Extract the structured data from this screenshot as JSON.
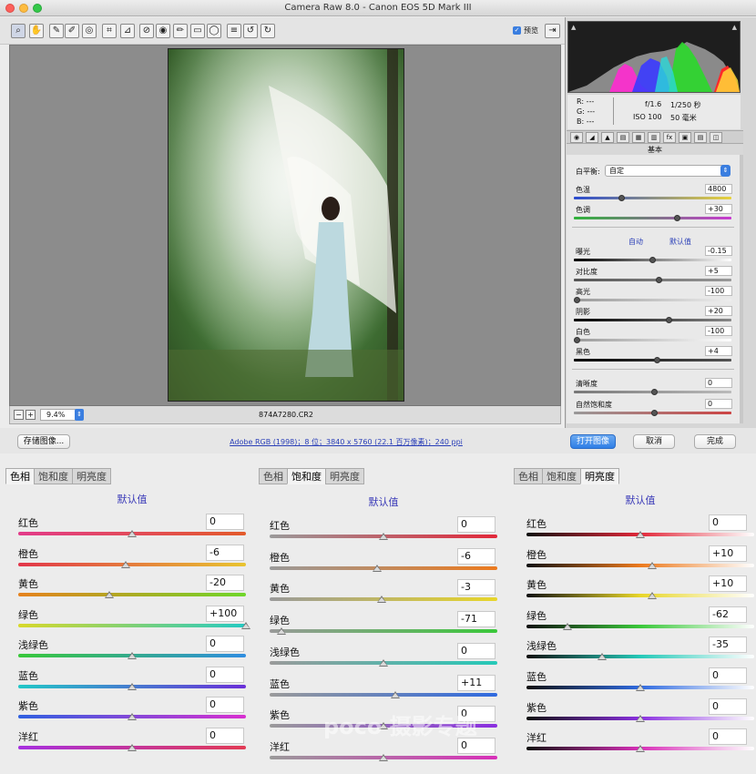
{
  "window": {
    "title": "Camera Raw 8.0 -  Canon EOS 5D Mark III"
  },
  "toolbar": {
    "tools": [
      "zoom-icon",
      "hand-icon",
      "white-balance-icon",
      "color-sampler-icon",
      "target-adjust-icon",
      "crop-icon",
      "straighten-icon",
      "spot-removal-icon",
      "red-eye-icon",
      "adjustment-brush-icon",
      "graduated-filter-icon",
      "radial-filter-icon",
      "list-icon",
      "rotate-left-icon",
      "rotate-right-icon"
    ],
    "preview_label": "预览",
    "preview_checked": true
  },
  "status": {
    "zoom": "9.4%",
    "filename": "874A7280.CR2"
  },
  "bottom": {
    "save_label": "存储图像...",
    "workflow_link": "Adobe RGB (1998)；8 位；3840 x 5760 (22.1 百万像素)；240 ppi",
    "open_label": "打开图像",
    "cancel_label": "取消",
    "done_label": "完成"
  },
  "info": {
    "r": "R:  ---",
    "g": "G:  ---",
    "b": "B:  ---",
    "aperture": "f/1.6",
    "shutter": "1/250 秒",
    "iso": "ISO 100",
    "focal": "50 毫米"
  },
  "panel": {
    "title": "基本",
    "wb_label": "白平衡:",
    "wb_value": "自定",
    "auto_label": "自动",
    "default_label": "默认值",
    "sliders": [
      {
        "label": "色温",
        "value": "4800",
        "pos": 0.29,
        "grad": "linear-gradient(90deg,#2a4ad0,#e8d23c)"
      },
      {
        "label": "色调",
        "value": "+30",
        "pos": 0.65,
        "grad": "linear-gradient(90deg,#2fb33a,#c83ad0)"
      },
      {
        "label": "曝光",
        "value": "-0.15",
        "pos": 0.49,
        "grad": "linear-gradient(90deg,#000,#fff)"
      },
      {
        "label": "对比度",
        "value": "+5",
        "pos": 0.53,
        "grad": "linear-gradient(90deg,#555,#999)"
      },
      {
        "label": "高光",
        "value": "-100",
        "pos": 0.0,
        "grad": "linear-gradient(90deg,#999,#eee)"
      },
      {
        "label": "阴影",
        "value": "+20",
        "pos": 0.6,
        "grad": "linear-gradient(90deg,#000,#888)"
      },
      {
        "label": "白色",
        "value": "-100",
        "pos": 0.0,
        "grad": "linear-gradient(90deg,#999,#fff)"
      },
      {
        "label": "黑色",
        "value": "+4",
        "pos": 0.52,
        "grad": "linear-gradient(90deg,#000,#555)"
      },
      {
        "label": "清晰度",
        "value": "0",
        "pos": 0.5,
        "grad": "linear-gradient(90deg,#777,#bbb)"
      },
      {
        "label": "自然饱和度",
        "value": "0",
        "pos": 0.5,
        "grad": "linear-gradient(90deg,#999,#c44)"
      }
    ]
  },
  "hsl": [
    {
      "tabs": [
        "色相",
        "饱和度",
        "明亮度"
      ],
      "active": 0,
      "default_label": "默认值",
      "rows": [
        {
          "label": "红色",
          "value": "0",
          "pos": 0.5,
          "grad": "linear-gradient(90deg,#e23b8a,#e35a2a)"
        },
        {
          "label": "橙色",
          "value": "-6",
          "pos": 0.47,
          "grad": "linear-gradient(90deg,#e2364a,#e8c430)"
        },
        {
          "label": "黄色",
          "value": "-20",
          "pos": 0.4,
          "grad": "linear-gradient(90deg,#e6821e,#6fd62a)"
        },
        {
          "label": "绿色",
          "value": "+100",
          "pos": 1.0,
          "grad": "linear-gradient(90deg,#d8d82a,#25c9c2)"
        },
        {
          "label": "浅绿色",
          "value": "0",
          "pos": 0.5,
          "grad": "linear-gradient(90deg,#39c83a,#2f8de0)"
        },
        {
          "label": "蓝色",
          "value": "0",
          "pos": 0.5,
          "grad": "linear-gradient(90deg,#22c7c7,#6a2fd8)"
        },
        {
          "label": "紫色",
          "value": "0",
          "pos": 0.5,
          "grad": "linear-gradient(90deg,#2f60e0,#d82fd0)"
        },
        {
          "label": "洋红",
          "value": "0",
          "pos": 0.5,
          "grad": "linear-gradient(90deg,#a62fe0,#e23a54)"
        }
      ]
    },
    {
      "tabs": [
        "色相",
        "饱和度",
        "明亮度"
      ],
      "active": 1,
      "default_label": "默认值",
      "rows": [
        {
          "label": "红色",
          "value": "0",
          "pos": 0.5,
          "grad": "linear-gradient(90deg,#9a9a9a,#e2283a)"
        },
        {
          "label": "橙色",
          "value": "-6",
          "pos": 0.47,
          "grad": "linear-gradient(90deg,#9a9a9a,#ec7a1e)"
        },
        {
          "label": "黄色",
          "value": "-3",
          "pos": 0.49,
          "grad": "linear-gradient(90deg,#9a9a9a,#e8d62a)"
        },
        {
          "label": "绿色",
          "value": "-71",
          "pos": 0.05,
          "grad": "linear-gradient(90deg,#9a9a9a,#3ac83a)"
        },
        {
          "label": "浅绿色",
          "value": "0",
          "pos": 0.5,
          "grad": "linear-gradient(90deg,#9a9a9a,#25c9b8)"
        },
        {
          "label": "蓝色",
          "value": "+11",
          "pos": 0.55,
          "grad": "linear-gradient(90deg,#9a9a9a,#2f6ae0)"
        },
        {
          "label": "紫色",
          "value": "0",
          "pos": 0.5,
          "grad": "linear-gradient(90deg,#9a9a9a,#8a2fe0)"
        },
        {
          "label": "洋红",
          "value": "0",
          "pos": 0.5,
          "grad": "linear-gradient(90deg,#9a9a9a,#d82fb8)"
        }
      ]
    },
    {
      "tabs": [
        "色相",
        "饱和度",
        "明亮度"
      ],
      "active": 2,
      "default_label": "默认值",
      "rows": [
        {
          "label": "红色",
          "value": "0",
          "pos": 0.5,
          "grad": "linear-gradient(90deg,#111,#e2283a,#fff)"
        },
        {
          "label": "橙色",
          "value": "+10",
          "pos": 0.55,
          "grad": "linear-gradient(90deg,#111,#ec7a1e,#fff)"
        },
        {
          "label": "黄色",
          "value": "+10",
          "pos": 0.55,
          "grad": "linear-gradient(90deg,#111,#e8d62a,#fff)"
        },
        {
          "label": "绿色",
          "value": "-62",
          "pos": 0.18,
          "grad": "linear-gradient(90deg,#111,#3ac83a,#fff)"
        },
        {
          "label": "浅绿色",
          "value": "-35",
          "pos": 0.33,
          "grad": "linear-gradient(90deg,#111,#25c9b8,#fff)"
        },
        {
          "label": "蓝色",
          "value": "0",
          "pos": 0.5,
          "grad": "linear-gradient(90deg,#111,#2f6ae0,#fff)"
        },
        {
          "label": "紫色",
          "value": "0",
          "pos": 0.5,
          "grad": "linear-gradient(90deg,#111,#8a2fe0,#fff)"
        },
        {
          "label": "洋红",
          "value": "0",
          "pos": 0.5,
          "grad": "linear-gradient(90deg,#111,#d82fb8,#fff)"
        }
      ]
    }
  ]
}
